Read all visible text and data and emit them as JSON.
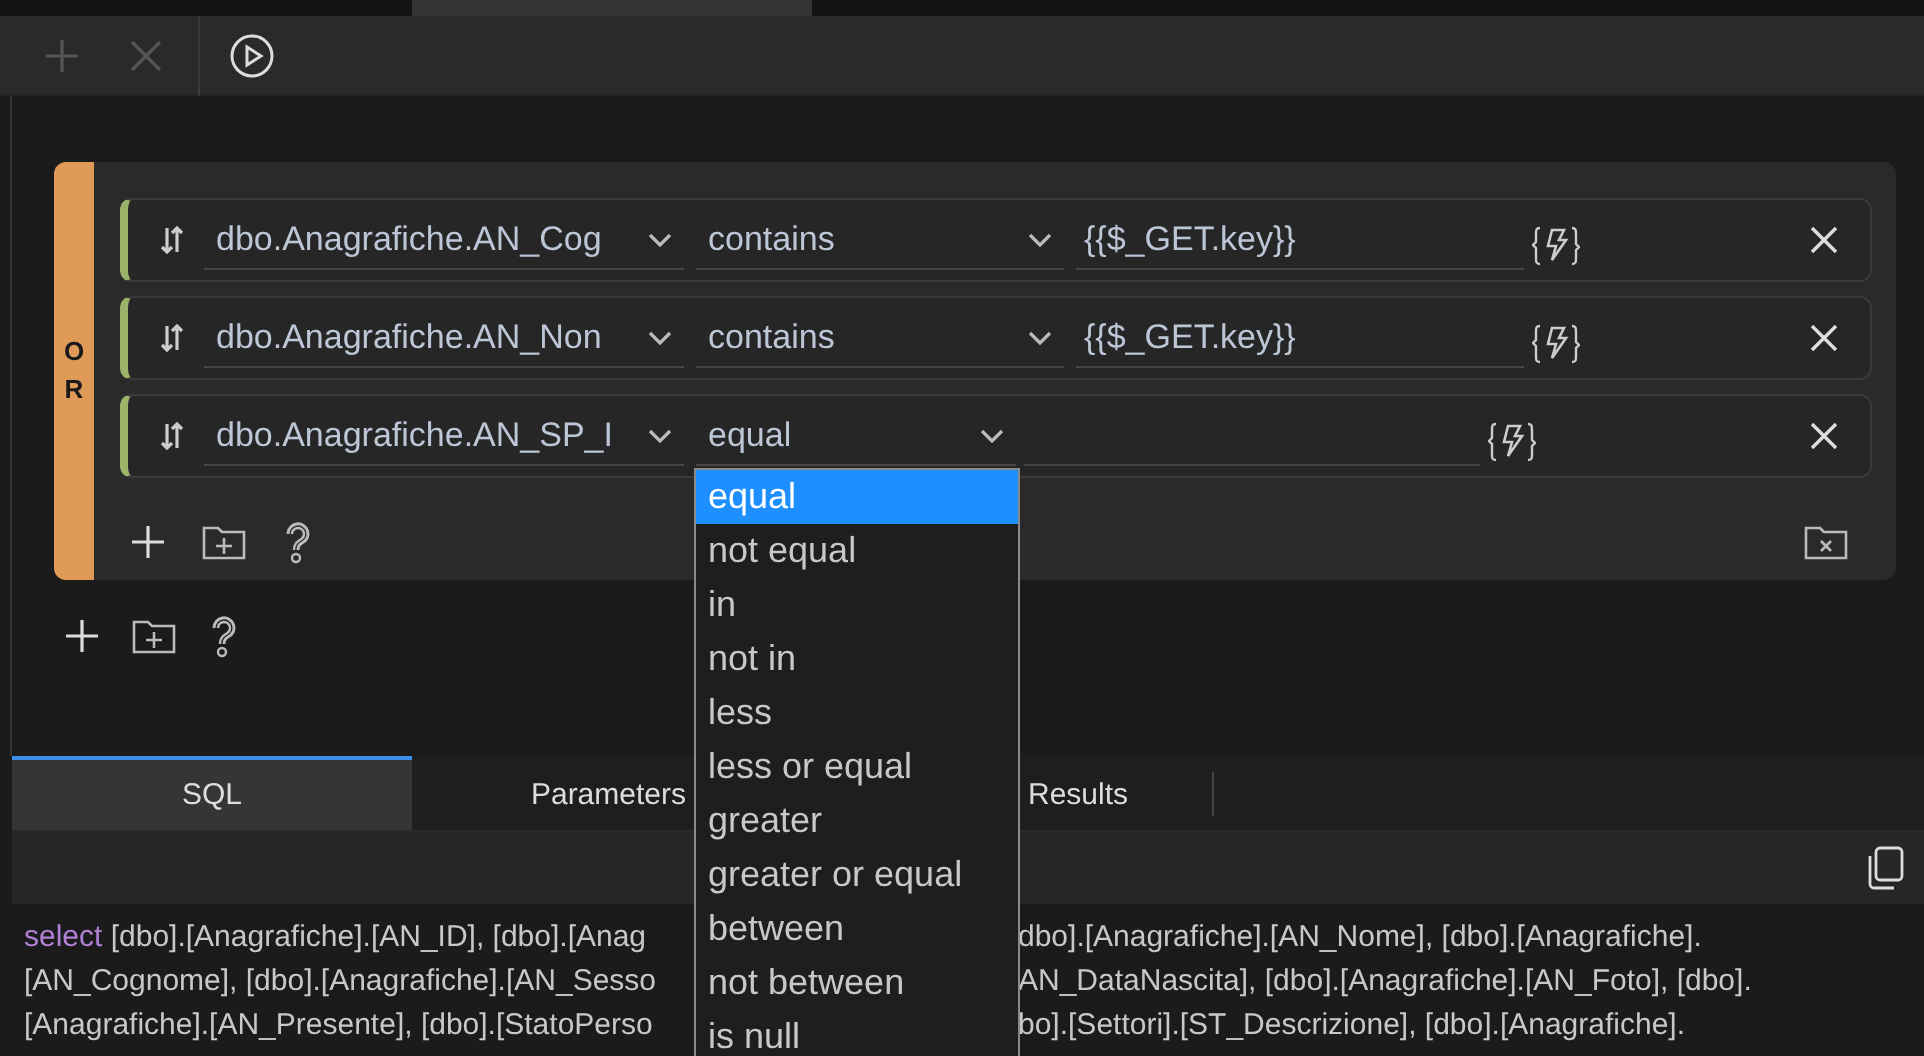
{
  "toolbar": {
    "buttons": [
      {
        "kind": "add",
        "disabled": true
      },
      {
        "kind": "remove",
        "disabled": true
      },
      {
        "kind": "run",
        "disabled": false
      }
    ]
  },
  "group": {
    "conjunction": "OR",
    "rows": [
      {
        "field": "dbo.Anagrafiche.AN_Cog",
        "operator": "contains",
        "value": "{{$_GET.key}}",
        "expanded": false
      },
      {
        "field": "dbo.Anagrafiche.AN_Non",
        "operator": "contains",
        "value": "{{$_GET.key}}",
        "expanded": false
      },
      {
        "field": "dbo.Anagrafiche.AN_SP_I",
        "operator": "equal",
        "expanded": true,
        "options": [
          {
            "label": "equal",
            "selected": true
          },
          {
            "label": "not equal",
            "selected": false
          },
          {
            "label": "in",
            "selected": false
          },
          {
            "label": "not in",
            "selected": false
          },
          {
            "label": "less",
            "selected": false
          },
          {
            "label": "less or equal",
            "selected": false
          },
          {
            "label": "greater",
            "selected": false
          },
          {
            "label": "greater or equal",
            "selected": false
          },
          {
            "label": "between",
            "selected": false
          },
          {
            "label": "not between",
            "selected": false
          },
          {
            "label": "is null",
            "selected": false
          }
        ]
      }
    ]
  },
  "tabs": [
    {
      "label": "SQL",
      "selected": true
    },
    {
      "label": "Parameters",
      "selected": false
    },
    {
      "label": "Results",
      "selected": false
    }
  ],
  "sql_lines": [
    {
      "keyword": "select",
      "left": "[dbo].[Anagrafiche].[AN_ID], [dbo].[Anag",
      "right": "dbo].[Anagrafiche].[AN_Nome], [dbo].[Anagrafiche]."
    },
    {
      "left": "[AN_Cognome], [dbo].[Anagrafiche].[AN_Sesso",
      "right": "AN_DataNascita], [dbo].[Anagrafiche].[AN_Foto], [dbo]."
    },
    {
      "left": "[Anagrafiche].[AN_Presente], [dbo].[StatoPerso",
      "right": "bo].[Settori].[ST_Descrizione], [dbo].[Anagrafiche]."
    }
  ]
}
